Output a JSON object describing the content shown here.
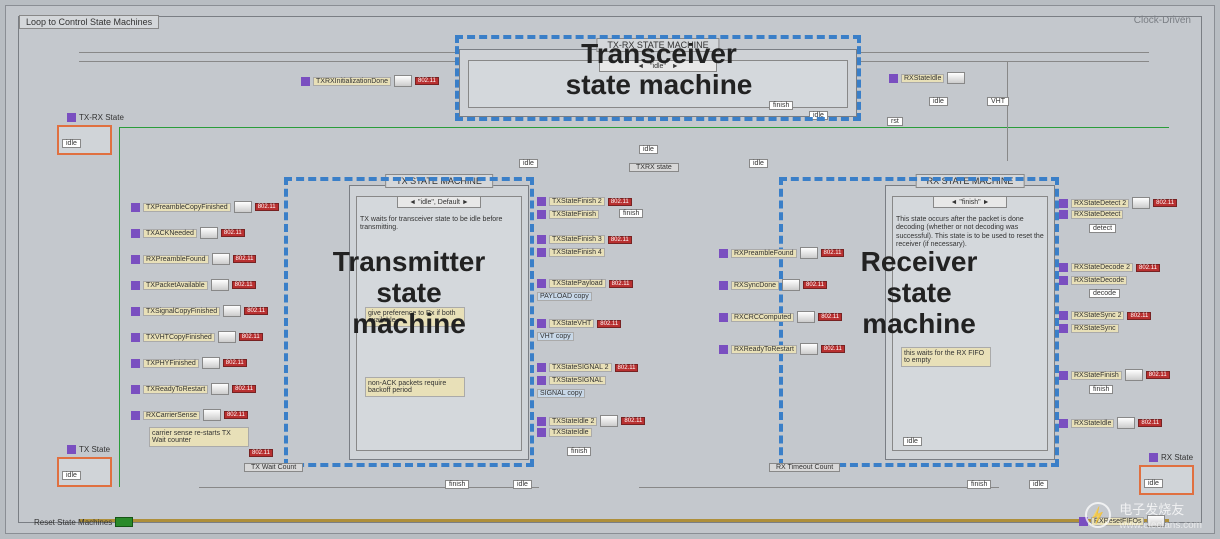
{
  "loop_label": "Loop to Control State Machines",
  "clock_label": "Clock-Driven",
  "txrx_machine_label": "TX-RX STATE MACHINE",
  "tx_machine_label": "TX STATE MACHINE",
  "rx_machine_label": "RX STATE MACHINE",
  "txrx_state_label": "TXRX state",
  "callouts": {
    "transceiver": "Transceiver\nstate machine",
    "transmitter": "Transmitter\nstate\nmachine",
    "receiver": "Receiver\nstate\nmachine"
  },
  "left_top_cluster": "TX-RX State",
  "left_bottom_cluster": "TX State",
  "right_bottom_cluster": "RX State",
  "reset_label": "Reset State Machines",
  "tx_inputs": [
    "TXRXInitializationDone",
    "TXPreambleCopyFinished",
    "TXACKNeeded",
    "RXPreambleFound",
    "TXPacketAvailable",
    "TXSignalCopyFinished",
    "TXVHTCopyFinished",
    "TXPHYFinished",
    "TXReadyToRestart",
    "RXCarrierSense"
  ],
  "tx_note": "carrier sense re-starts TX Wait counter",
  "tx_wait_label": "TX Wait Count",
  "tx_case_label": "\"idle\", Default",
  "tx_case_text": "TX waits for transceiver state to be idle before transmitting.",
  "tx_case_note2": "give preference to Rx if both available",
  "tx_case_note3": "non-ACK packets require backoff period",
  "tx_outputs_a": [
    "TXStateFinish 2",
    "TXStateFinish"
  ],
  "tx_outputs_b": [
    "TXStateFinish 3",
    "TXStateFinish 4"
  ],
  "tx_payload": [
    "TXStatePayload",
    "PAYLOAD copy"
  ],
  "tx_vht": [
    "TXStateVHT",
    "VHT copy"
  ],
  "tx_signal": [
    "TXStateSIGNAL 2",
    "TXStateSIGNAL",
    "SIGNAL copy"
  ],
  "tx_idle": [
    "TXStateIdle 2",
    "TXStateIdle"
  ],
  "rx_inputs": [
    "RXPreambleFound",
    "RXSyncDone",
    "RXCRCComputed",
    "RXReadyToRestart"
  ],
  "rx_case_label": "\"finish\"",
  "rx_case_text": "This state occurs after the packet is done decoding (whether or not decoding was successful). This state is to be used to reset the receiver (if necessary).",
  "rx_case_note": "this waits for the RX FIFO to empty",
  "rx_timeout_label": "RX Timeout Count",
  "rx_outputs": [
    "RXStateIdle",
    "RXStateDetect 2",
    "RXStateDetect",
    "RXStateDecode 2",
    "RXStateDecode",
    "RXStateSync 2",
    "RXStateSync",
    "RXStateFinish",
    "RXStateIdle"
  ],
  "rx_reset_fifo": "RXResetFIFOs",
  "top_right_terms": [
    "RXStateIdle"
  ],
  "wm_chars": "电子发烧友",
  "wm_url": "www.elecfans.com",
  "idle_word": "idle",
  "rst_word": "rst",
  "finish_word": "finish",
  "detect_word": "detect",
  "decode_word": "decode",
  "vht_word": "VHT",
  "finish_short": "finish",
  "red_tag": "802.11"
}
